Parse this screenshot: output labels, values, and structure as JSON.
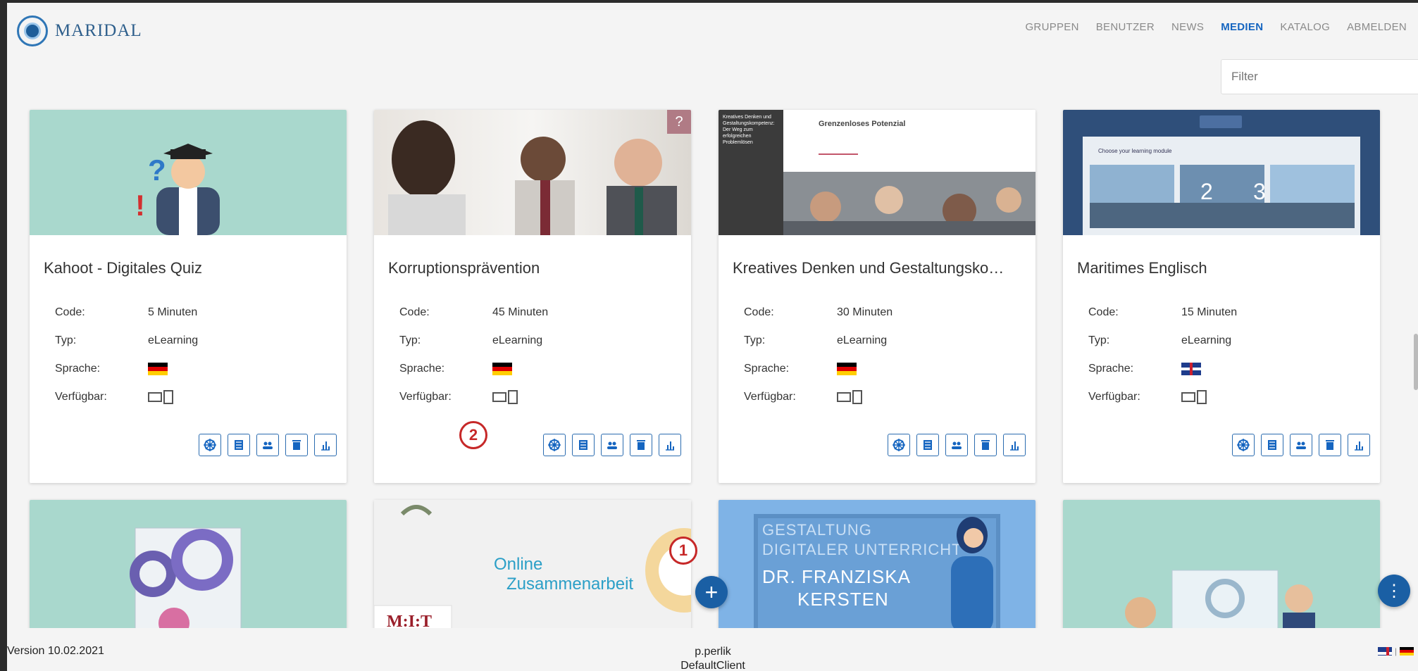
{
  "brand": {
    "name": "MARIDAL"
  },
  "nav": {
    "items": [
      "GRUPPEN",
      "BENUTZER",
      "NEWS",
      "MEDIEN",
      "KATALOG",
      "ABMELDEN"
    ],
    "active": "MEDIEN"
  },
  "filter": {
    "placeholder": "Filter"
  },
  "labels": {
    "code": "Code:",
    "typ": "Typ:",
    "sprache": "Sprache:",
    "verfuegbar": "Verfügbar:"
  },
  "cards": [
    {
      "title": "Kahoot - Digitales Quiz",
      "code": "5 Minuten",
      "typ": "eLearning",
      "lang": "de"
    },
    {
      "title": "Korruptionsprävention",
      "code": "45 Minuten",
      "typ": "eLearning",
      "lang": "de",
      "badge": "?"
    },
    {
      "title": "Kreatives Denken und Gestaltungsko…",
      "code": "30 Minuten",
      "typ": "eLearning",
      "lang": "de"
    },
    {
      "title": "Maritimes Englisch",
      "code": "15 Minuten",
      "typ": "eLearning",
      "lang": "gb"
    }
  ],
  "thumb_texts": {
    "card3_heading": "Grenzenloses Potenzial",
    "card3_side": "Kreatives Denken und Gestaltungskompetenz: Der Weg zum erfolgreichen Problemlösen",
    "card4_banner": "Choose your learning module",
    "card4_nums": [
      "2",
      "3"
    ],
    "row2_online": "Online",
    "row2_zusammenarbeit": "Zusammenarbeit",
    "row2_mit": "M:I:T",
    "row2_gestaltung": "GESTALTUNG",
    "row2_digital": "DIGITALER UNTERRICHT",
    "row2_dr": "DR. FRANZISKA",
    "row2_kersten": "KERSTEN"
  },
  "callouts": {
    "one": "1",
    "two": "2"
  },
  "fab": {
    "add": "+",
    "more": "⋮"
  },
  "footer": {
    "version": "Version 10.02.2021",
    "user": "p.perlik",
    "client": "DefaultClient",
    "separator": "|"
  },
  "colors": {
    "accent": "#1565c0",
    "callout": "#c62828",
    "mint": "#a9d8cd",
    "lightblue": "#7fb3e6"
  }
}
